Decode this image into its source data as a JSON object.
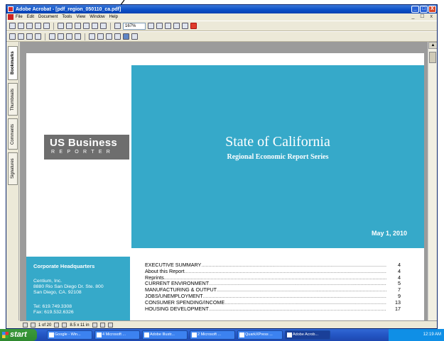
{
  "window": {
    "title": "Adobe Acrobat - [pdf_region_050110_ca.pdf]",
    "controls": [
      "_",
      "□",
      "X"
    ],
    "doc_controls": "_ ☐ x"
  },
  "menubar": {
    "items": [
      "File",
      "Edit",
      "Document",
      "Tools",
      "View",
      "Window",
      "Help"
    ]
  },
  "toolbar": {
    "zoom": "167%"
  },
  "left_tabs": [
    "Bookmarks",
    "Thumbnails",
    "Comments",
    "Signatures"
  ],
  "page": {
    "logo_line1": "US Business",
    "logo_line2": "REPORTER",
    "title": "State of California",
    "subtitle": "Regional Economic Report Series",
    "date": "May 1, 2010",
    "hq": {
      "title": "Corporate Headquarters",
      "company": "Centium, Inc.",
      "address1": "8880 Rio San Diego Dr. Ste. 800",
      "address2": "San Diego, CA. 92108",
      "tel": "Tel:  619.749.3308",
      "fax": "Fax: 619.532.6326"
    },
    "toc": [
      {
        "label": "EXECUTIVE SUMMARY",
        "page": "4"
      },
      {
        "label": "About this Report",
        "page": "4"
      },
      {
        "label": "Reprints",
        "page": "4"
      },
      {
        "label": "CURRENT ENVIRONMENT",
        "page": "5"
      },
      {
        "label": "MANUFACTURING & OUTPUT",
        "page": "7"
      },
      {
        "label": "JOBS/UNEMPLOYMENT",
        "page": "9"
      },
      {
        "label": "CONSUMER SPENDING/INCOME",
        "page": "13"
      },
      {
        "label": "HOUSING DEVELOPMENT",
        "page": "17"
      }
    ],
    "toc_dots": "............................................................................................................................................................................"
  },
  "statusbar": {
    "page_indicator": "1 of 20",
    "page_size": "8.5 x 11 in"
  },
  "taskbar": {
    "start": "start",
    "tasks": [
      "Google - Win...",
      "4 Microsoft ...",
      "Adobe Illustr...",
      "2 Microsoft ...",
      "QuarkXPress ...",
      "Adobe Acrob..."
    ],
    "clock": "12:19 AM"
  }
}
